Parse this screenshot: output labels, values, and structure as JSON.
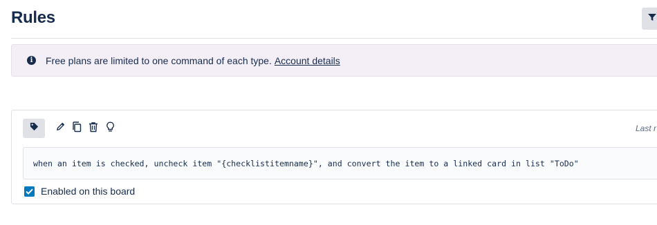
{
  "header": {
    "title": "Rules"
  },
  "notice": {
    "text": "Free plans are limited to one command of each type.",
    "link_label": "Account details"
  },
  "rule": {
    "last_modified_label": "Last r",
    "command_text": "when an item is checked, uncheck item \"{checklistitemname}\", and convert the item to a linked card in list \"ToDo\"",
    "enabled_label": "Enabled on this board",
    "enabled": true
  },
  "icons": {
    "filter": "filter-icon",
    "info": "info-icon",
    "tag": "tag-icon",
    "edit": "pencil-icon",
    "copy": "copy-icon",
    "delete": "trash-icon",
    "suggest": "lightbulb-icon",
    "check": "checkmark-icon"
  },
  "colors": {
    "notice_bg": "#f4eff7",
    "checkbox": "#0079bf",
    "text": "#172b4d",
    "active_button": "#dfe1e6"
  }
}
